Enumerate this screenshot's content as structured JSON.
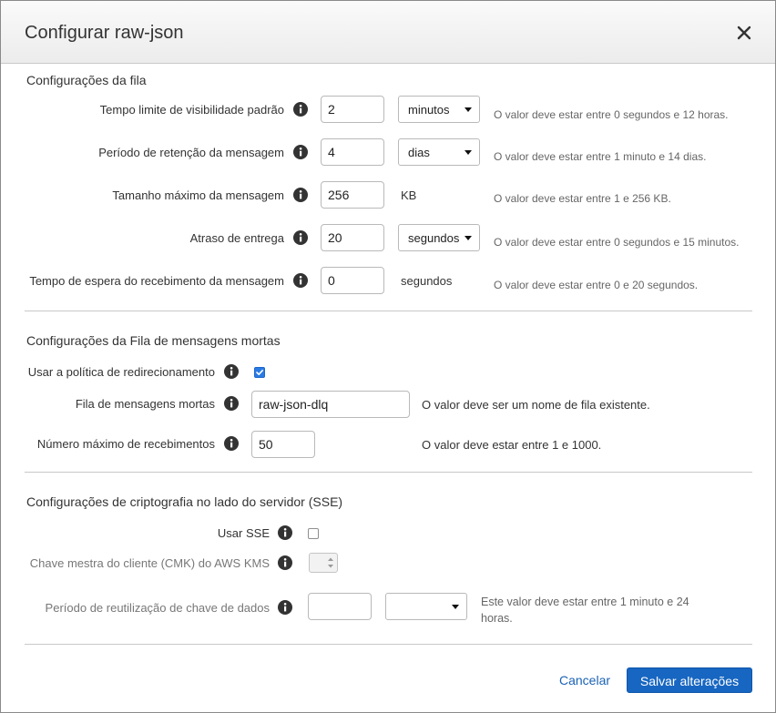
{
  "dialog": {
    "title": "Configurar raw-json"
  },
  "queue_settings": {
    "section_title": "Configurações da fila",
    "visibility_timeout": {
      "label": "Tempo limite de visibilidade padrão",
      "value": "2",
      "unit": "minutos",
      "help": "O valor deve estar entre 0 segundos e 12 horas."
    },
    "retention_period": {
      "label": "Período de retenção da mensagem",
      "value": "4",
      "unit": "dias",
      "help": "O valor deve estar entre 1 minuto e 14 dias."
    },
    "max_message_size": {
      "label": "Tamanho máximo da mensagem",
      "value": "256",
      "unit": "KB",
      "help": "O valor deve estar entre 1 e 256 KB."
    },
    "delivery_delay": {
      "label": "Atraso de entrega",
      "value": "20",
      "unit": "segundos",
      "help": "O valor deve estar entre 0 segundos e 15 minutos."
    },
    "receive_wait_time": {
      "label": "Tempo de espera do recebimento da mensagem",
      "value": "0",
      "unit": "segundos",
      "help": "O valor deve estar entre 0 e 20 segundos."
    }
  },
  "dead_letter": {
    "section_title": "Configurações da Fila de mensagens mortas",
    "use_redrive": {
      "label": "Usar a política de redirecionamento",
      "checked": true
    },
    "dlq_name": {
      "label": "Fila de mensagens mortas",
      "value": "raw-json-dlq",
      "help": "O valor deve ser um nome de fila existente."
    },
    "max_receives": {
      "label": "Número máximo de recebimentos",
      "value": "50",
      "help": "O valor deve estar entre 1 e 1000."
    }
  },
  "sse": {
    "section_title": "Configurações de criptografia no lado do servidor (SSE)",
    "use_sse": {
      "label": "Usar SSE",
      "checked": false
    },
    "cmk": {
      "label": "Chave mestra do cliente (CMK) do AWS KMS"
    },
    "reuse_period": {
      "label": "Período de reutilização de chave de dados",
      "value": "",
      "unit": "",
      "help": "Este valor deve estar entre 1 minuto e 24 horas."
    }
  },
  "footer": {
    "cancel_label": "Cancelar",
    "save_label": "Salvar alterações"
  },
  "colors": {
    "primary": "#1766c1",
    "link": "#1a62b5",
    "checkbox": "#2a7be4"
  },
  "icons": {
    "info": "info-circle-icon",
    "close": "close-icon",
    "caret": "caret-down-icon"
  }
}
